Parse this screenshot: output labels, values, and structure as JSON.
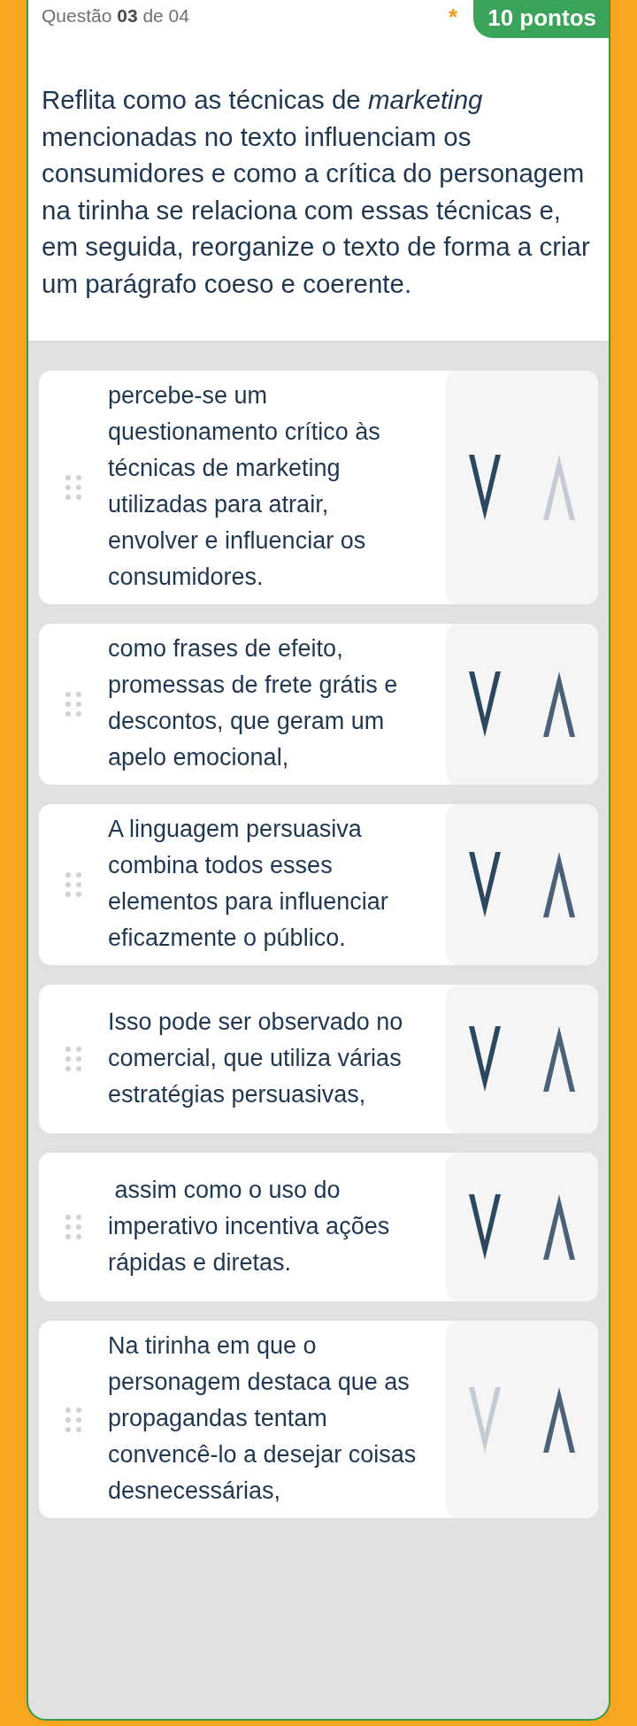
{
  "header": {
    "question_label": "Questão **03** de 04",
    "required_mark": "*",
    "points": "10 pontos"
  },
  "prompt": "Reflita como as técnicas de *marketing* mencionadas no texto influenciam os consumidores e como a crítica do personagem na tirinha se relaciona com essas técnicas e, em seguida, reorganize o texto de forma a criar um parágrafo coeso e coerente.",
  "items": [
    {
      "text": "percebe-se um questionamento crítico às técnicas de marketing utilizadas para atrair, envolver e influenciar os consumidores.",
      "down_disabled": false,
      "up_disabled": true
    },
    {
      "text": "como frases de efeito, promessas de frete grátis e descontos, que geram um apelo emocional,",
      "down_disabled": false,
      "up_disabled": false
    },
    {
      "text": "A linguagem persuasiva combina todos esses elementos para influenciar eficazmente o público.",
      "down_disabled": false,
      "up_disabled": false
    },
    {
      "text": "Isso pode ser observado no comercial, que utiliza várias estratégias persuasivas,",
      "down_disabled": false,
      "up_disabled": false
    },
    {
      "text": " assim como o uso do imperativo incentiva ações rápidas e diretas.",
      "down_disabled": false,
      "up_disabled": false
    },
    {
      "text": "Na tirinha em que o personagem destaca que as propagandas tentam convencê-lo a desejar coisas desnecessárias,",
      "down_disabled": true,
      "up_disabled": false
    }
  ]
}
